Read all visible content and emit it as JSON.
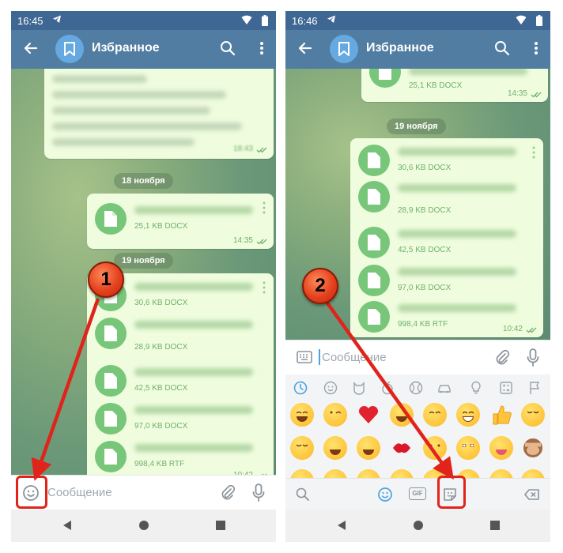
{
  "left": {
    "status": {
      "time": "16:45"
    },
    "header": {
      "title": "Избранное"
    },
    "files_top": [],
    "date1": "18 ноября",
    "bubble2": {
      "meta": "25,1 KB DOCX",
      "time": "14:35"
    },
    "date2": "19 ноября",
    "bubble1_time": "18:43",
    "files": [
      {
        "meta": "30,6 KB DOCX"
      },
      {
        "meta": "28,9 KB DOCX"
      },
      {
        "meta": "42,5 KB DOCX"
      },
      {
        "meta": "97,0 KB DOCX"
      },
      {
        "meta": "998,4 KB RTF"
      }
    ],
    "bubble3_time": "10:42",
    "input": {
      "placeholder": "Сообщение"
    }
  },
  "right": {
    "status": {
      "time": "16:46"
    },
    "header": {
      "title": "Избранное"
    },
    "bubble_top": {
      "meta": "25,1 KB DOCX",
      "time": "14:35"
    },
    "date": "19 ноября",
    "files": [
      {
        "meta": "30,6 KB DOCX"
      },
      {
        "meta": "28,9 KB DOCX"
      },
      {
        "meta": "42,5 KB DOCX"
      },
      {
        "meta": "97,0 KB DOCX"
      },
      {
        "meta": "998,4 KB RTF"
      }
    ],
    "bubble_time": "10:42",
    "input": {
      "placeholder": "Сообщение"
    },
    "emoji_bottom": {
      "gif": "GIF"
    }
  },
  "markers": {
    "step1": "1",
    "step2": "2"
  },
  "colors": {
    "appbar": "#517da2",
    "statusbar": "#3f6793",
    "bubble": "#effdde",
    "file_icon": "#78c67a",
    "meta_text": "#70b06a",
    "highlight": "#e0231b",
    "marker": "#e4421e"
  },
  "icons": [
    "back-arrow-icon",
    "bookmark-icon",
    "search-icon",
    "more-vertical-icon",
    "file-icon",
    "emoji-icon",
    "attach-icon",
    "mic-icon",
    "keyboard-icon",
    "sticker-icon",
    "gif-icon",
    "backspace-icon"
  ]
}
